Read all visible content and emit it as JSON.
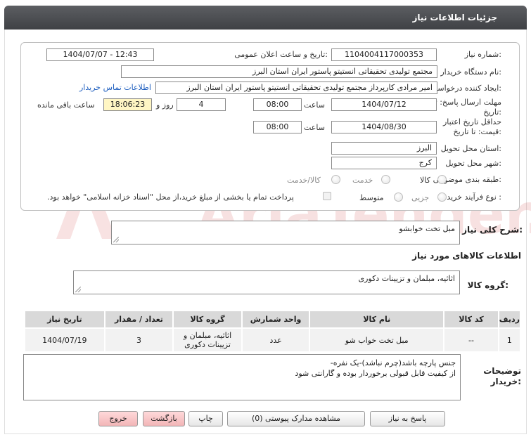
{
  "header": {
    "title": "جزئیات اطلاعات نیاز"
  },
  "fields": {
    "need_number_label": "شماره نیاز:",
    "need_number": "1104004117000353",
    "announce_label": "تاریخ و ساعت اعلان عمومی:",
    "announce_value": "1404/07/07 - 12:43",
    "buyer_org_label": "نام دستگاه خریدار:",
    "buyer_org": "مجتمع تولیدی تحقیقاتی انستیتو پاستور ایران استان البرز",
    "requester_label": "ایجاد کننده درخواست:",
    "requester": "امیر مرادی کارپرداز مجتمع تولیدی تحقیقاتی انستیتو پاستور ایران استان البرز",
    "contact_link": "اطلاعات تماس خریدار",
    "deadline_label_1": "مهلت ارسال پاسخ: تا",
    "deadline_label_2": "تاریخ:",
    "deadline_date": "1404/07/12",
    "time_label": "ساعت",
    "deadline_time": "08:00",
    "days_value": "4",
    "days_label": "روز و",
    "remaining_time": "18:06:23",
    "remaining_label": "ساعت باقی مانده",
    "validity_label_1": "حداقل تاریخ اعتبار",
    "validity_label_2": "قیمت: تا تاریخ:",
    "validity_date": "1404/08/30",
    "validity_time": "08:00",
    "province_label": "استان محل تحویل:",
    "province": "البرز",
    "city_label": "شهر محل تحویل:",
    "city": "کرج",
    "category_label": "طبقه بندی موضوعی:",
    "category_options": [
      "کالا",
      "خدمت",
      "کالا/خدمت"
    ],
    "process_label": "نوع فرآیند خرید :",
    "process_options": [
      "جزیی",
      "متوسط"
    ],
    "process_note": "پرداخت تمام یا بخشی از مبلغ خرید،از محل \"اسناد خزانه اسلامی\" خواهد بود."
  },
  "summary": {
    "label": "شرح کلی نیاز:",
    "value": "مبل تخت خوابشو"
  },
  "goods_section": {
    "title": "اطلاعات کالاهای مورد نیاز"
  },
  "goods_group": {
    "label": "گروه کالا:",
    "value": "اثاثیه، مبلمان و تزیینات دکوری"
  },
  "table": {
    "headers": [
      "ردیف",
      "کد کالا",
      "نام کالا",
      "واحد شمارش",
      "گروه کالا",
      "تعداد / مقدار",
      "تاریخ نیاز"
    ],
    "rows": [
      [
        "1",
        "--",
        "مبل تخت خواب شو",
        "عدد",
        "اثاثیه، مبلمان و تزیینات دکوری",
        "3",
        "1404/07/19"
      ]
    ]
  },
  "buyer_notes": {
    "label_1": "توضیحات",
    "label_2": "خریدار:",
    "line_1": "جنس پارچه باشد(چرم نباشد)-یک نفره-",
    "line_2": "از کیفیت قابل قبولی برخوردار بوده و گارانتی شود"
  },
  "buttons": {
    "reply": "پاسخ به نیاز",
    "attachments": "مشاهده مدارک پیوستی (0)",
    "print": "چاپ",
    "back": "بازگشت",
    "exit": "خروج"
  },
  "watermark": {
    "text": "AriaTender.net"
  },
  "colors": {
    "header_bg": "#4a4c50",
    "link": "#1f5fbf",
    "highlight": "#fff6c4",
    "watermark": "#c81e1e"
  }
}
